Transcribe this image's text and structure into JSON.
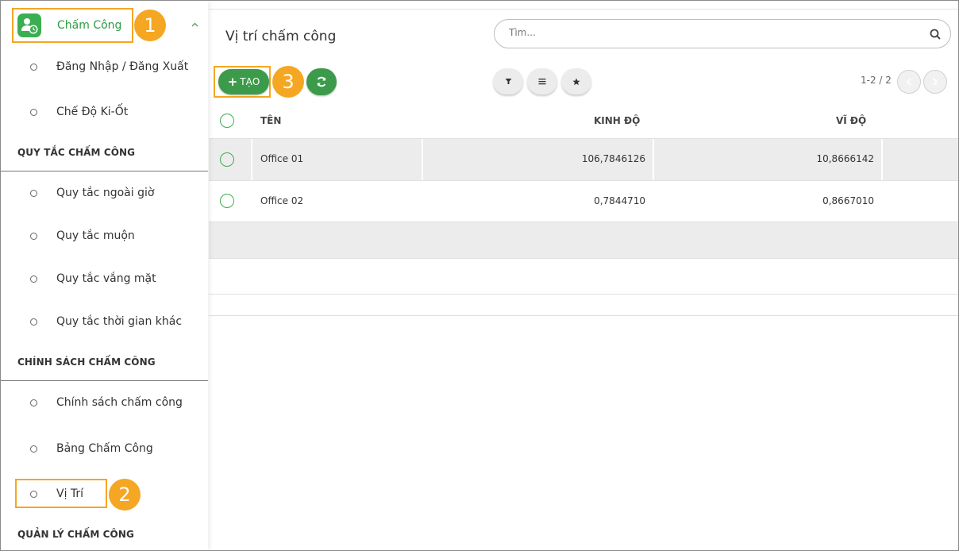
{
  "sidebar": {
    "module_label": "Chấm Công",
    "items_top": [
      {
        "label": "Đăng Nhập / Đăng Xuất"
      },
      {
        "label": "Chế Độ Ki-Ốt"
      }
    ],
    "section1_title": "QUY TẮC CHẤM CÔNG",
    "items_rules": [
      {
        "label": "Quy tắc ngoài giờ"
      },
      {
        "label": "Quy tắc muộn"
      },
      {
        "label": "Quy tắc vắng mặt"
      },
      {
        "label": "Quy tắc thời gian khác"
      }
    ],
    "section2_title": "CHÍNH SÁCH CHẤM CÔNG",
    "items_policy": [
      {
        "label": "Chính sách chấm công"
      },
      {
        "label": "Bảng Chấm Công"
      },
      {
        "label": "Vị Trí"
      }
    ],
    "section3_title": "QUẢN LÝ CHẤM CÔNG"
  },
  "badges": [
    "1",
    "2",
    "3"
  ],
  "main": {
    "title": "Vị trí chấm công",
    "search_placeholder": "Tìm...",
    "create_label": "TẠO",
    "pager": "1-2 / 2"
  },
  "table": {
    "headers": {
      "name": "TÊN",
      "lng": "KINH ĐỘ",
      "lat": "VĨ ĐỘ"
    },
    "rows": [
      {
        "name": "Office 01",
        "lng": "106,7846126",
        "lat": "10,8666142"
      },
      {
        "name": "Office 02",
        "lng": "0,7844710",
        "lat": "0,8667010"
      }
    ]
  },
  "colors": {
    "accent": "#3b9b4a",
    "highlight": "#f5a623",
    "row_shade": "#ececec"
  },
  "icons": [
    "attendance-module-icon",
    "chevron-up-icon",
    "search-icon",
    "plus-icon",
    "refresh-icon",
    "filter-icon",
    "list-icon",
    "star-icon",
    "chevron-left-icon",
    "chevron-right-icon"
  ]
}
